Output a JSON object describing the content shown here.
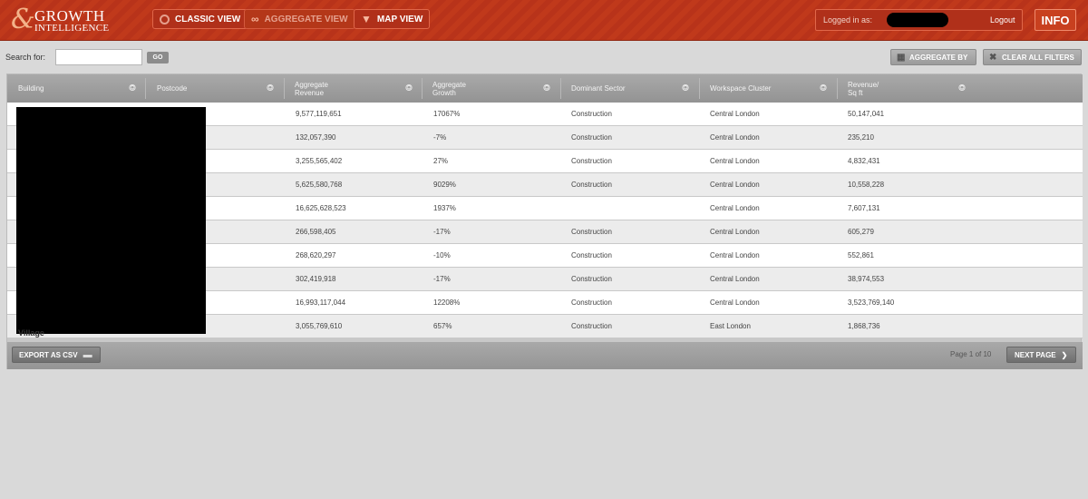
{
  "header": {
    "logo_line1": "GROWTH",
    "logo_line2": "INTELLIGENCE",
    "logo_glyph": "&",
    "nav": [
      {
        "label": "CLASSIC VIEW",
        "icon": "circle-icon"
      },
      {
        "label": "AGGREGATE VIEW",
        "icon": "link-icon"
      },
      {
        "label": "MAP VIEW",
        "icon": "pin-icon"
      }
    ],
    "logged_in_label": "Logged in as:",
    "logout_label": "Logout",
    "info_label": "INFO",
    "accent_color": "#c0391b"
  },
  "toolbar": {
    "search_label": "Search for:",
    "search_value": "",
    "go_label": "GO",
    "aggregate_by_label": "AGGREGATE BY",
    "clear_filters_label": "CLEAR ALL FILTERS"
  },
  "table": {
    "columns": [
      {
        "label": "Building"
      },
      {
        "label": "Postcode"
      },
      {
        "label": "Aggregate\nRevenue"
      },
      {
        "label": "Aggregate\nGrowth"
      },
      {
        "label": "Dominant Sector"
      },
      {
        "label": "Workspace Cluster"
      },
      {
        "label": "Revenue/\nSq ft"
      }
    ],
    "rows": [
      [
        "",
        "",
        "9,577,119,651",
        "17067%",
        "Construction",
        "Central London",
        "50,147,041"
      ],
      [
        "",
        "",
        "132,057,390",
        "-7%",
        "Construction",
        "Central London",
        "235,210"
      ],
      [
        "",
        "",
        "3,255,565,402",
        "27%",
        "Construction",
        "Central London",
        "4,832,431"
      ],
      [
        "",
        "",
        "5,625,580,768",
        "9029%",
        "Construction",
        "Central London",
        "10,558,228"
      ],
      [
        "",
        "",
        "16,625,628,523",
        "1937%",
        "",
        "Central London",
        "7,607,131"
      ],
      [
        "",
        "",
        "266,598,405",
        "-17%",
        "Construction",
        "Central London",
        "605,279"
      ],
      [
        "",
        "",
        "268,620,297",
        "-10%",
        "Construction",
        "Central London",
        "552,861"
      ],
      [
        "",
        "",
        "302,419,918",
        "-17%",
        "Construction",
        "Central London",
        "38,974,553"
      ],
      [
        "",
        "",
        "16,993,117,044",
        "12208%",
        "Construction",
        "Central London",
        "3,523,769,140"
      ],
      [
        "Village",
        "",
        "3,055,769,610",
        "657%",
        "Construction",
        "East London",
        "1,868,736"
      ]
    ]
  },
  "footer": {
    "export_label": "EXPORT AS CSV",
    "page_info": "Page 1 of 10",
    "next_label": "NEXT PAGE"
  }
}
